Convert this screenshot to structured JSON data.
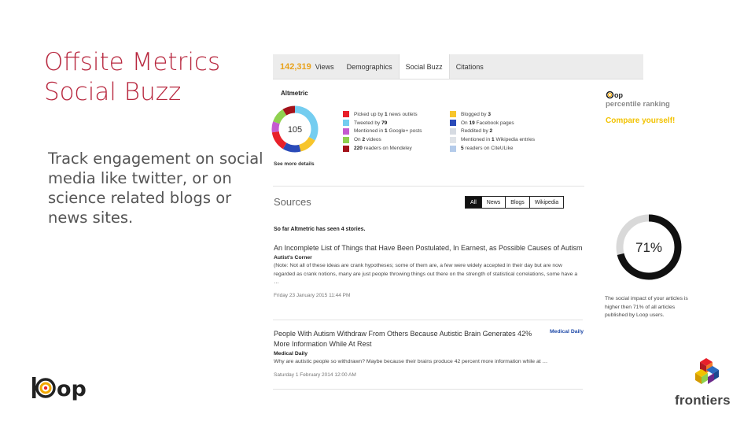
{
  "slide": {
    "title_line1": "Offsite Metrics",
    "title_line2": "Social Buzz",
    "body": "Track engagement on social media like twitter, or on science related blogs or news sites."
  },
  "tabs": {
    "views_count": "142,319",
    "views_label": "Views",
    "demographics": "Demographics",
    "social_buzz": "Social Buzz",
    "citations": "Citations"
  },
  "altmetric": {
    "title": "Altmetric",
    "score": "105",
    "see_more": "See more details",
    "col1": [
      {
        "pre": "Picked up by ",
        "num": "1",
        "post": " news outlets",
        "color": "#e8202a"
      },
      {
        "pre": "Tweeted by ",
        "num": "79",
        "post": "",
        "color": "#74cdf0"
      },
      {
        "pre": "Mentioned in ",
        "num": "1",
        "post": " Google+ posts",
        "color": "#c55bd0"
      },
      {
        "pre": "On ",
        "num": "2",
        "post": " videos",
        "color": "#8fd14f"
      },
      {
        "pre": "",
        "num": "220",
        "post": " readers on Mendeley",
        "color": "#a3121a"
      }
    ],
    "col2": [
      {
        "pre": "Blogged by ",
        "num": "3",
        "post": "",
        "color": "#f7c52c"
      },
      {
        "pre": "On ",
        "num": "19",
        "post": " Facebook pages",
        "color": "#2a4ab8"
      },
      {
        "pre": "Reddited by ",
        "num": "2",
        "post": "",
        "color": "#d6dbe2"
      },
      {
        "pre": "Mentioned in ",
        "num": "1",
        "post": " Wikipedia entries",
        "color": "#dfe3e8"
      },
      {
        "pre": "",
        "num": "5",
        "post": " readers on CiteULike",
        "color": "#b4cbea"
      }
    ]
  },
  "sources": {
    "title": "Sources",
    "filters": [
      "All",
      "News",
      "Blogs",
      "Wikipedia"
    ],
    "seen_text": "So far Altmetric has seen 4 stories."
  },
  "stories": [
    {
      "headline": "An Incomplete List of Things that Have Been Postulated, In Earnest, as Possible Causes of Autism",
      "source": "Autist's Corner",
      "excerpt": "(Note: Not all of these ideas are crank hypotheses; some of them are, a few were widely accepted in their day but are now regarded as crank notions, many are just people throwing things out there on the strength of statistical correlations, some have a …",
      "date": "Friday 23 January 2015 11:44 PM"
    },
    {
      "headline": "People With Autism Withdraw From Others Because Autistic Brain Generates 42% More Information While At Rest",
      "badge": "Medical Daily",
      "source": "Medical Daily",
      "excerpt": "Why are autistic people so withdrawn? Maybe because their brains produce 42 percent more information while at …",
      "date": "Saturday 1 February 2014 12:00 AM"
    }
  ],
  "ranking": {
    "brand": "op",
    "percentile_label": "percentile ranking",
    "compare": "Compare yourself!",
    "percent_value": 71,
    "percent_text": "71%",
    "note": "The social impact of your articles is higher then  71% of all articles published by Loop users."
  },
  "logos": {
    "loop_text": "op",
    "frontiers_text": "frontiers"
  }
}
